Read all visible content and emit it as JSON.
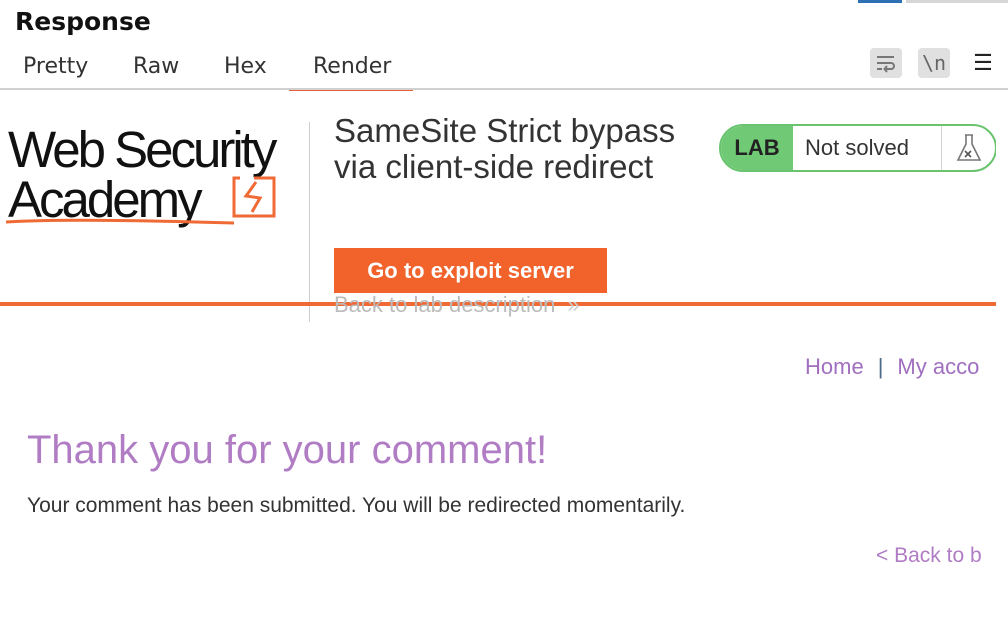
{
  "panel": {
    "title": "Response",
    "tabs": [
      {
        "label": "Pretty"
      },
      {
        "label": "Raw"
      },
      {
        "label": "Hex"
      },
      {
        "label": "Render"
      }
    ],
    "active_tab": "Render",
    "tools": {
      "wrap_icon": "word-wrap-icon",
      "newline_label": "\\n",
      "menu_icon": "hamburger-menu-icon"
    }
  },
  "page": {
    "logo": {
      "line1": "Web Security",
      "line2": "Academy"
    },
    "lab_title": "SameSite Strict bypass via client-side redirect",
    "exploit_button": "Go to exploit server",
    "back_to_description": "Back to lab description",
    "back_chevron": "»",
    "lab_badge": {
      "tag": "LAB",
      "status": "Not solved",
      "icon": "flask-icon"
    },
    "nav": {
      "home": "Home",
      "separator": "|",
      "account": "My acco"
    },
    "heading": "Thank you for your comment!",
    "message": "Your comment has been submitted. You will be redirected momentarily.",
    "back_link": "< Back to b"
  },
  "colors": {
    "accent_orange": "#f2632c",
    "lab_green": "#70c975",
    "link_purple": "#b07cc4",
    "tab_underline": "#e8603a"
  }
}
